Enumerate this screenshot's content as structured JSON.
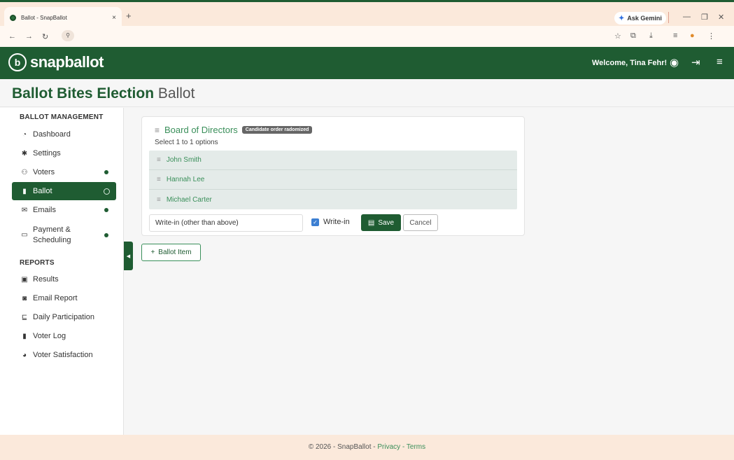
{
  "browser": {
    "tab_title": "Ballot - SnapBallot",
    "tab_close": "×",
    "new_tab": "+",
    "gemini_label": "Ask Gemini",
    "site_info": "⚲"
  },
  "app": {
    "logo_text": "snapballot",
    "welcome": "Welcome, Tina Fehr!"
  },
  "page": {
    "title_main": "Ballot Bites Election",
    "title_sub": "Ballot"
  },
  "sidebar": {
    "management_header": "BALLOT MANAGEMENT",
    "items": [
      {
        "label": "Dashboard"
      },
      {
        "label": "Settings"
      },
      {
        "label": "Voters"
      },
      {
        "label": "Ballot"
      },
      {
        "label": "Emails"
      },
      {
        "label": "Payment &"
      },
      {
        "label": "Scheduling"
      }
    ],
    "reports_header": "REPORTS",
    "reports": [
      {
        "label": "Results"
      },
      {
        "label": "Email Report"
      },
      {
        "label": "Daily Participation"
      },
      {
        "label": "Voter Log"
      },
      {
        "label": "Voter Satisfaction"
      }
    ]
  },
  "ballot_item": {
    "title": "Board of Directors",
    "badge": "Candidate order radomized",
    "subtitle": "Select 1 to 1 options",
    "options": [
      {
        "label": "John Smith"
      },
      {
        "label": "Hannah Lee"
      },
      {
        "label": "Michael Carter"
      }
    ],
    "writein_value": "Write-in (other than above)",
    "writein_label": "Write-in",
    "save_label": "Save",
    "cancel_label": "Cancel"
  },
  "add_item_label": "Ballot Item",
  "footer": {
    "copyright": "© 2026 - SnapBallot - ",
    "privacy": "Privacy",
    "sep": " - ",
    "terms": "Terms"
  }
}
